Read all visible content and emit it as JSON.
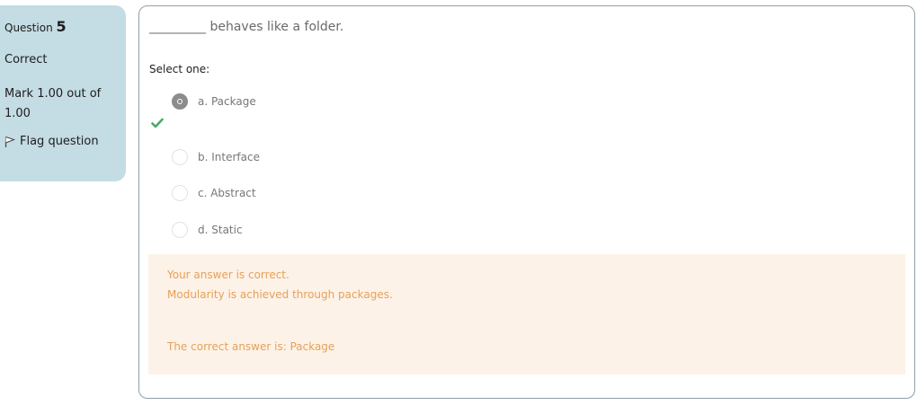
{
  "info": {
    "question_label": "Question",
    "question_number": "5",
    "state": "Correct",
    "grade": "Mark 1.00 out of 1.00",
    "flag_label": "Flag question"
  },
  "question": {
    "text": "_________ behaves like a folder.",
    "prompt": "Select one:",
    "options": [
      {
        "label": "a. Package",
        "selected": true,
        "correct": true
      },
      {
        "label": "b. Interface",
        "selected": false
      },
      {
        "label": "c. Abstract",
        "selected": false
      },
      {
        "label": "d. Static",
        "selected": false
      }
    ]
  },
  "feedback": {
    "specific": "Your answer is correct.",
    "general": "Modularity is achieved through packages.",
    "right_answer": "The correct answer is: Package"
  },
  "colors": {
    "info_bg": "#c4dce3",
    "feedback_bg": "#fdf2e7",
    "feedback_text": "#e6a158",
    "correct_check": "#4aa96c"
  }
}
